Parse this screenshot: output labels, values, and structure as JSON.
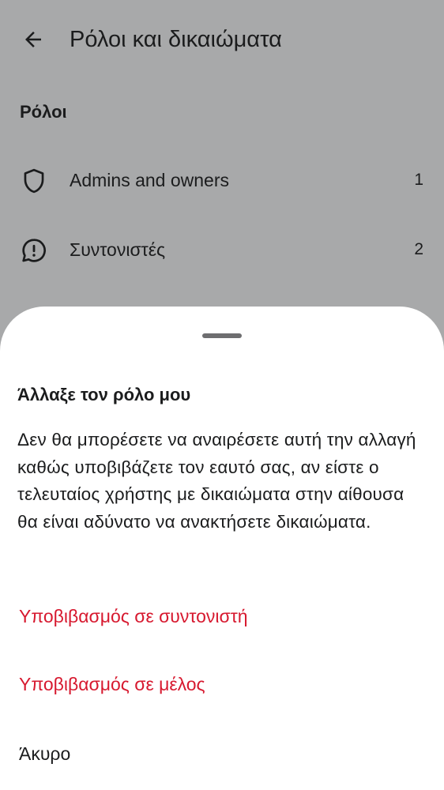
{
  "header": {
    "title": "Ρόλοι και δικαιώματα",
    "back_icon": "arrow-left-icon"
  },
  "roles_section": {
    "heading": "Ρόλοι",
    "items": [
      {
        "label": "Admins and owners",
        "count": "1",
        "icon": "shield-icon"
      },
      {
        "label": "Συντονιστές",
        "count": "2",
        "icon": "chat-alert-icon"
      }
    ]
  },
  "sheet": {
    "title": "Άλλαξε τον ρόλο μου",
    "body": "Δεν θα μπορέσετε να αναιρέσετε αυτή την αλλαγή καθώς υποβιβάζετε τον εαυτό σας, αν είστε ο τελευταίος χρήστης με δικαιώματα στην αίθουσα θα είναι αδύνατο να ανακτήσετε δικαιώματα.",
    "actions": {
      "demote_moderator": "Υποβιβασμός σε συντονιστή",
      "demote_member": "Υποβιβασμός σε μέλος",
      "cancel": "Άκυρο"
    }
  },
  "colors": {
    "scrim_background": "#a8a9aa",
    "sheet_background": "#ffffff",
    "danger": "#d7192f",
    "text_primary": "#1b1c1d",
    "handle": "#6e6e70"
  }
}
